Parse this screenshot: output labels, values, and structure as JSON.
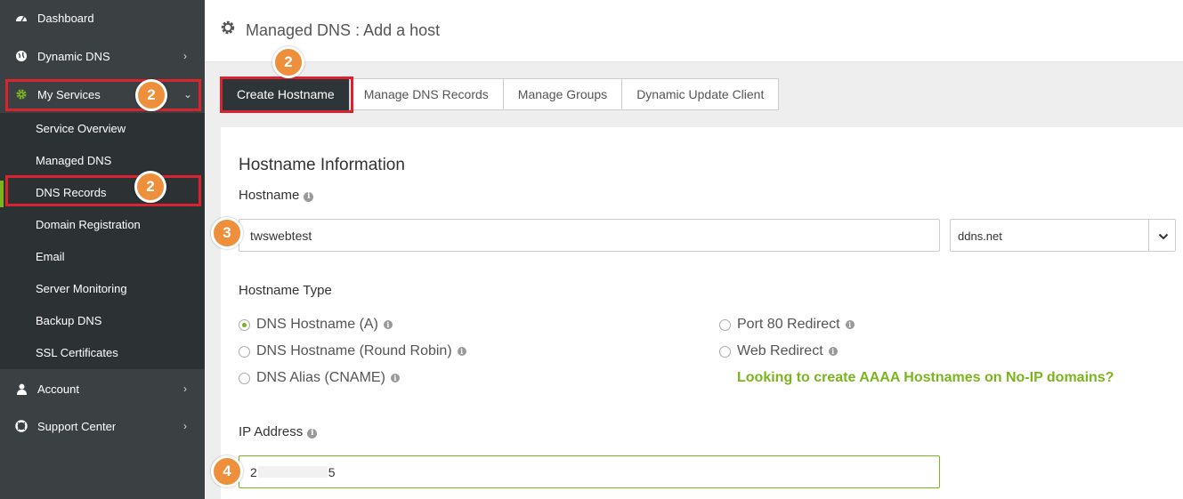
{
  "sidebar": {
    "items": [
      {
        "label": "Dashboard"
      },
      {
        "label": "Dynamic DNS"
      },
      {
        "label": "My Services"
      },
      {
        "label": "Account"
      },
      {
        "label": "Support Center"
      }
    ],
    "submenu": [
      {
        "label": "Service Overview"
      },
      {
        "label": "Managed DNS"
      },
      {
        "label": "DNS Records"
      },
      {
        "label": "Domain Registration"
      },
      {
        "label": "Email"
      },
      {
        "label": "Server Monitoring"
      },
      {
        "label": "Backup DNS"
      },
      {
        "label": "SSL Certificates"
      }
    ]
  },
  "header": {
    "title": "Managed DNS : Add a host"
  },
  "tabs": [
    {
      "label": "Create Hostname",
      "active": true
    },
    {
      "label": "Manage DNS Records"
    },
    {
      "label": "Manage Groups"
    },
    {
      "label": "Dynamic Update Client"
    }
  ],
  "form": {
    "section_title": "Hostname Information",
    "hostname_label": "Hostname",
    "hostname_value": "twswebtest",
    "domain_value": "ddns.net",
    "type_label": "Hostname Type",
    "types_left": [
      "DNS Hostname (A)",
      "DNS Hostname (Round Robin)",
      "DNS Alias (CNAME)"
    ],
    "types_right": [
      "Port 80 Redirect",
      "Web Redirect"
    ],
    "selected_type": "DNS Hostname (A)",
    "aaaa_link": "Looking to create AAAA Hostnames on No-IP domains?",
    "ip_label": "IP Address",
    "ip_prefix": "2",
    "ip_suffix": "5"
  },
  "annotations": {
    "badge_services": "2",
    "badge_records": "2",
    "badge_tab": "2",
    "badge_hostname": "3",
    "badge_ip": "4"
  },
  "colors": {
    "sidebar": "#3b4043",
    "submenu": "#2c3134",
    "accent_green": "#7ab51d",
    "badge_orange": "#ed8f3b",
    "highlight_red": "#d9232e"
  }
}
